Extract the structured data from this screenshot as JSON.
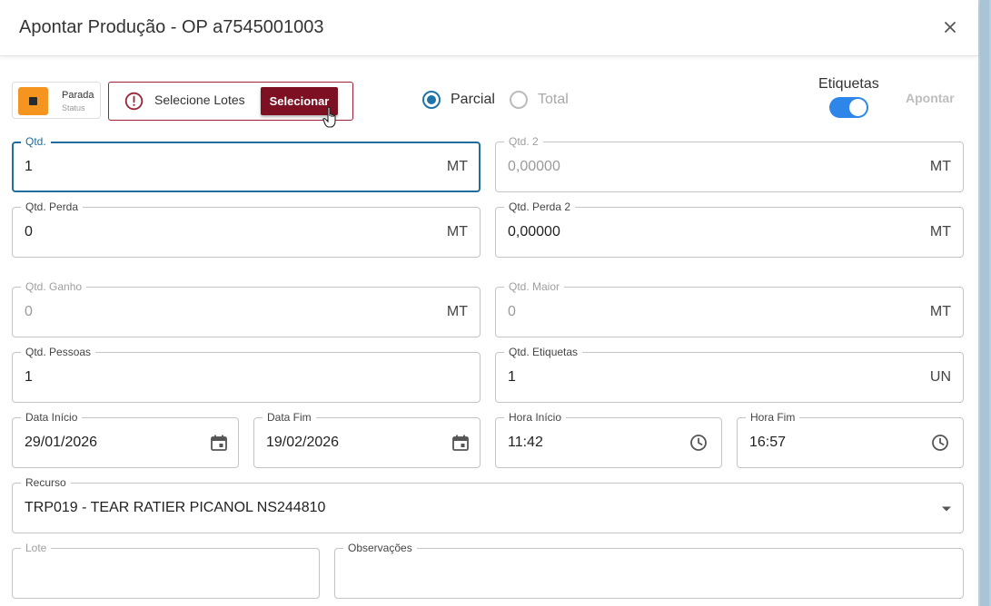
{
  "dialog": {
    "title": "Apontar Produção - OP a7545001003",
    "close_label": "×"
  },
  "status": {
    "name": "Parada",
    "sub": "Status",
    "color": "#f5941e"
  },
  "lotes": {
    "warning_text": "Selecione Lotes",
    "button_label": "Selecionar"
  },
  "mode": {
    "options": [
      "Parcial",
      "Total"
    ],
    "selected": "Parcial"
  },
  "etiquetas": {
    "label": "Etiquetas",
    "enabled": true
  },
  "actions": {
    "apontar_label": "Apontar"
  },
  "fields": {
    "qtd": {
      "label": "Qtd.",
      "value": "1",
      "unit": "MT"
    },
    "qtd2": {
      "label": "Qtd. 2",
      "value": "0,00000",
      "unit": "MT"
    },
    "qtd_perda": {
      "label": "Qtd. Perda",
      "value": "0",
      "unit": "MT"
    },
    "qtd_perda2": {
      "label": "Qtd. Perda 2",
      "value": "0,00000",
      "unit": "MT"
    },
    "qtd_ganho": {
      "label": "Qtd. Ganho",
      "value": "0",
      "unit": "MT"
    },
    "qtd_maior": {
      "label": "Qtd. Maior",
      "value": "0",
      "unit": "MT"
    },
    "qtd_pessoas": {
      "label": "Qtd. Pessoas",
      "value": "1"
    },
    "qtd_etiquetas": {
      "label": "Qtd. Etiquetas",
      "value": "1",
      "unit": "UN"
    },
    "data_inicio": {
      "label": "Data Início",
      "value": "29/01/2026"
    },
    "data_fim": {
      "label": "Data Fim",
      "value": "19/02/2026"
    },
    "hora_inicio": {
      "label": "Hora Início",
      "value": "11:42"
    },
    "hora_fim": {
      "label": "Hora Fim",
      "value": "16:57"
    },
    "recurso": {
      "label": "Recurso",
      "value": "TRP019 - TEAR RATIER PICANOL NS244810"
    },
    "lote": {
      "label": "Lote",
      "value": ""
    },
    "observacoes": {
      "label": "Observações",
      "value": ""
    }
  },
  "colors": {
    "accent": "#1f6d9c",
    "brand": "#7d1022",
    "toggle": "#2e86e8"
  }
}
